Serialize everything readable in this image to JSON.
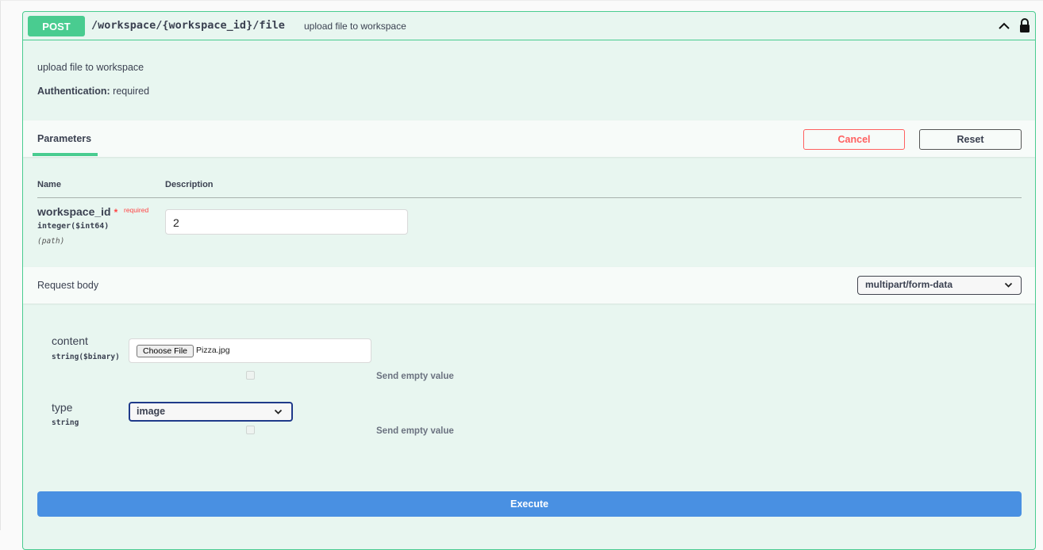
{
  "operation": {
    "method": "POST",
    "path": "/workspace/{workspace_id}/file",
    "summary": "upload file to workspace",
    "description": "upload file to workspace",
    "auth_label": "Authentication:",
    "auth_value": "required",
    "method_color": "#49cc90"
  },
  "parameters_section": {
    "tab_label": "Parameters",
    "cancel_label": "Cancel",
    "reset_label": "Reset",
    "col_name": "Name",
    "col_description": "Description",
    "params": [
      {
        "name": "workspace_id",
        "required_mark": "*",
        "required_label": "required",
        "type": "integer($int64)",
        "in": "(path)",
        "value": "2"
      }
    ]
  },
  "request_body": {
    "label": "Request body",
    "content_type": "multipart/form-data",
    "fields": [
      {
        "name": "content",
        "type": "string($binary)",
        "choose_file_label": "Choose File",
        "file_name": "Pizza.jpg",
        "send_empty_label": "Send empty value"
      },
      {
        "name": "type",
        "type": "string",
        "selected": "image",
        "send_empty_label": "Send empty value"
      }
    ]
  },
  "execute_label": "Execute",
  "colors": {
    "execute": "#4990e2",
    "cancel": "#ff6060",
    "background": "#e8f6f0"
  }
}
